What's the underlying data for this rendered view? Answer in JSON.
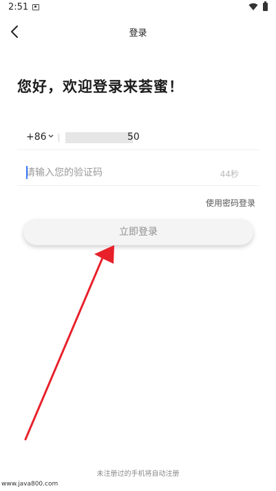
{
  "status_bar": {
    "time": "2:51"
  },
  "header": {
    "title": "登录"
  },
  "welcome": "您好，欢迎登录来荟蜜！",
  "phone": {
    "country_code": "+86",
    "number_suffix": "50"
  },
  "code": {
    "placeholder": "请输入您的验证码",
    "countdown": "44秒"
  },
  "password_login_link": "使用密码登录",
  "login_button": "立即登录",
  "footer_note": "未注册过的手机将自动注册",
  "watermark": "www.java800.com",
  "colors": {
    "annotation_arrow": "#e8202a",
    "caret": "#3a7bff"
  }
}
